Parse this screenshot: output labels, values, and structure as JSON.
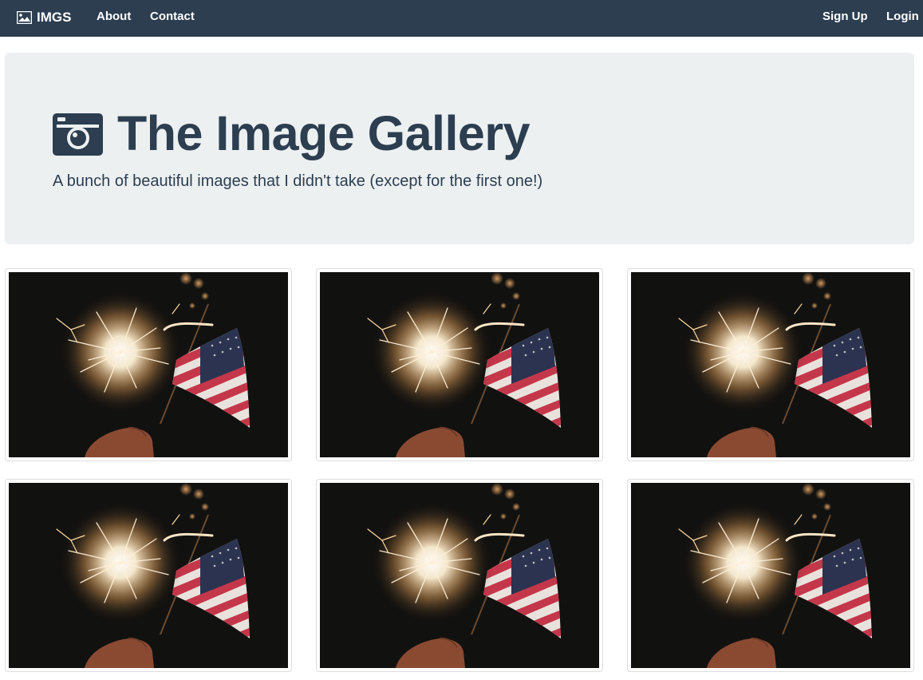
{
  "navbar": {
    "brand": {
      "label": "IMGS",
      "icon": "image-icon"
    },
    "left_links": [
      "About",
      "Contact"
    ],
    "right_links": [
      "Sign Up",
      "Login"
    ],
    "colors": {
      "background": "#2c3e50",
      "text": "#ffffff"
    }
  },
  "jumbotron": {
    "icon": "camera-icon",
    "title": "The Image Gallery",
    "subtitle": "A bunch of beautiful images that I didn't take (except for the first one!)",
    "colors": {
      "background": "#ecf0f1",
      "text": "#2c3e50"
    }
  },
  "gallery": {
    "images": [
      {
        "subject": "sparkler-and-american-flag"
      },
      {
        "subject": "sparkler-and-american-flag"
      },
      {
        "subject": "sparkler-and-american-flag"
      },
      {
        "subject": "sparkler-and-american-flag"
      },
      {
        "subject": "sparkler-and-american-flag"
      },
      {
        "subject": "sparkler-and-american-flag"
      }
    ]
  }
}
